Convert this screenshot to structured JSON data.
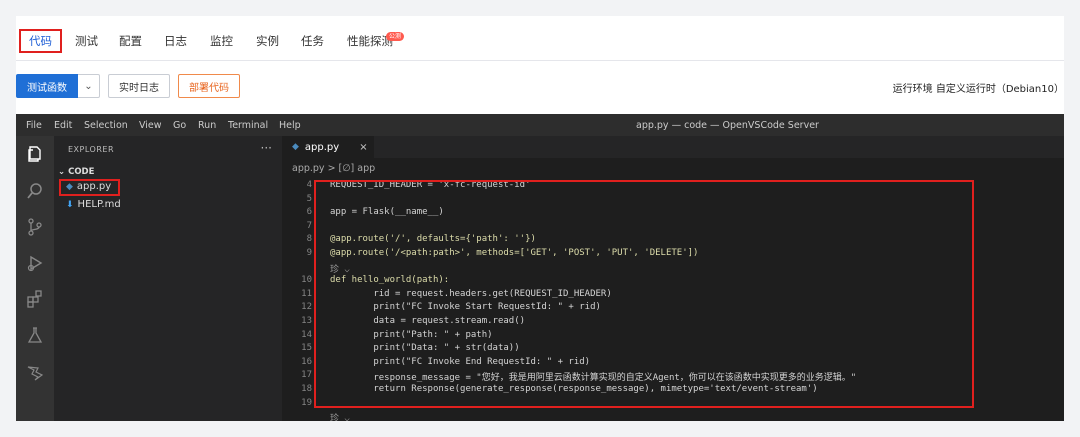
{
  "tabs": [
    "代码",
    "测试",
    "配置",
    "日志",
    "监控",
    "实例",
    "任务",
    "性能探测"
  ],
  "beta_badge": "公测",
  "toolbar": {
    "test_button": "测试函数",
    "caret": "⌄",
    "realtime_log_button": "实时日志",
    "deploy_button": "部署代码",
    "runtime_label": "运行环境 自定义运行时（Debian10）"
  },
  "vscode": {
    "menu": [
      "File",
      "Edit",
      "Selection",
      "View",
      "Go",
      "Run",
      "Terminal",
      "Help"
    ],
    "window_title": "app.py — code — OpenVSCode Server",
    "explorer_title": "EXPLORER",
    "explorer_more": "···",
    "section": "CODE",
    "files": [
      "app.py",
      "HELP.md"
    ],
    "editor_tab": "app.py",
    "editor_tab_close": "×",
    "breadcrumb": "app.py  >  [∅] app",
    "code_lines": [
      {
        "n": "4",
        "text": "REQUEST_ID_HEADER = 'x-fc-request-id'"
      },
      {
        "n": "5",
        "text": ""
      },
      {
        "n": "6",
        "text": "app = Flask(__name__)"
      },
      {
        "n": "7",
        "text": ""
      },
      {
        "n": "8",
        "text": "@app.route('/', defaults={'path': ''})"
      },
      {
        "n": "9",
        "text": "@app.route('/<path:path>', methods=['GET', 'POST', 'PUT', 'DELETE'])"
      },
      {
        "n": "",
        "text": "珍 ⌵"
      },
      {
        "n": "10",
        "text": "def hello_world(path):"
      },
      {
        "n": "11",
        "text": "        rid = request.headers.get(REQUEST_ID_HEADER)"
      },
      {
        "n": "12",
        "text": "        print(\"FC Invoke Start RequestId: \" + rid)"
      },
      {
        "n": "13",
        "text": "        data = request.stream.read()"
      },
      {
        "n": "14",
        "text": "        print(\"Path: \" + path)"
      },
      {
        "n": "15",
        "text": "        print(\"Data: \" + str(data))"
      },
      {
        "n": "16",
        "text": "        print(\"FC Invoke End RequestId: \" + rid)"
      },
      {
        "n": "17",
        "text": "        response_message = \"您好，我是用阿里云函数计算实现的自定义Agent，你可以在该函数中实现更多的业务逻辑。\""
      },
      {
        "n": "18",
        "text": "        return Response(generate_response(response_message), mimetype='text/event-stream')"
      },
      {
        "n": "19",
        "text": ""
      },
      {
        "n": "",
        "text": "珍 ⌵"
      }
    ]
  },
  "colors": {
    "accent": "#1f6fd6",
    "highlight": "#e0201e",
    "deploy": "#e8641e"
  }
}
